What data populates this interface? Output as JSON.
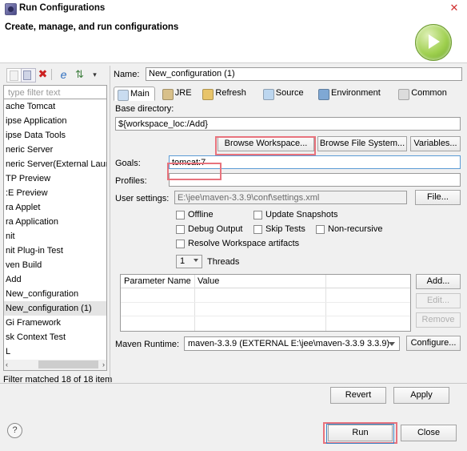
{
  "window": {
    "title": "Run Configurations",
    "subtitle": "Create, manage, and run configurations",
    "close_label": "✕",
    "run_banner_icon": "run-play-icon",
    "help_label": "?"
  },
  "left_toolbar": {
    "buttons": [
      {
        "name": "new-configuration-icon",
        "label": ""
      },
      {
        "name": "duplicate-configuration-icon",
        "label": ""
      },
      {
        "name": "delete-configuration-icon",
        "label": "✖"
      },
      {
        "name": "collapse-all-icon",
        "label": "e"
      },
      {
        "name": "filter-sort-icon",
        "label": "⇅"
      },
      {
        "name": "view-menu-caret-icon",
        "label": "▾"
      }
    ]
  },
  "filter": {
    "placeholder": "type filter text",
    "value": "",
    "status": "Filter matched 18 of 18 item"
  },
  "tree": {
    "items": [
      {
        "label": "ache Tomcat",
        "selected": false
      },
      {
        "label": "ipse Application",
        "selected": false
      },
      {
        "label": "ipse Data Tools",
        "selected": false
      },
      {
        "label": "neric Server",
        "selected": false
      },
      {
        "label": "neric Server(External Launch",
        "selected": false
      },
      {
        "label": "TP Preview",
        "selected": false
      },
      {
        "label": ":E Preview",
        "selected": false
      },
      {
        "label": "ra Applet",
        "selected": false
      },
      {
        "label": "ra Application",
        "selected": false
      },
      {
        "label": "nit",
        "selected": false
      },
      {
        "label": "nit Plug-in Test",
        "selected": false
      },
      {
        "label": "ven Build",
        "selected": false
      },
      {
        "label": "  Add",
        "selected": false
      },
      {
        "label": "  New_configuration",
        "selected": false
      },
      {
        "label": "  New_configuration (1)",
        "selected": true
      },
      {
        "label": "Gi Framework",
        "selected": false
      },
      {
        "label": "sk Context Test",
        "selected": false
      },
      {
        "label": "L",
        "selected": false
      }
    ],
    "scroll_left_arrow": "‹",
    "scroll_right_arrow": "›"
  },
  "config": {
    "name_label": "Name:",
    "name_value": "New_configuration (1)",
    "tabs": [
      {
        "label": "Main",
        "icon": "main-tab-icon",
        "active": true,
        "color": "#c9dcf0"
      },
      {
        "label": "JRE",
        "icon": "jre-tab-icon",
        "active": false,
        "color": "#d8c08a"
      },
      {
        "label": "Refresh",
        "icon": "refresh-tab-icon",
        "active": false,
        "color": "#e8c46a"
      },
      {
        "label": "Source",
        "icon": "source-tab-icon",
        "active": false,
        "color": "#bcd6ef"
      },
      {
        "label": "Environment",
        "icon": "environment-tab-icon",
        "active": false,
        "color": "#7fa8d4"
      },
      {
        "label": "Common",
        "icon": "common-tab-icon",
        "active": false,
        "color": "#dcdcdc"
      }
    ],
    "base_directory_label": "Base directory:",
    "base_directory_value": "${workspace_loc:/Add}",
    "browse_workspace_label": "Browse Workspace...",
    "browse_filesystem_label": "Browse File System...",
    "variables_label": "Variables...",
    "goals_label": "Goals:",
    "goals_value": "tomcat:7",
    "profiles_label": "Profiles:",
    "profiles_value": "",
    "user_settings_label": "User settings:",
    "user_settings_value": "E:\\jee\\maven-3.3.9\\conf\\settings.xml",
    "file_button_label": "File...",
    "checkboxes": [
      {
        "label": "Offline",
        "checked": false
      },
      {
        "label": "Update Snapshots",
        "checked": false
      },
      {
        "label": "Debug Output",
        "checked": false
      },
      {
        "label": "Skip Tests",
        "checked": false
      },
      {
        "label": "Non-recursive",
        "checked": false
      },
      {
        "label": "Resolve Workspace artifacts",
        "checked": false
      }
    ],
    "threads_value": "1",
    "threads_label": "Threads",
    "table": {
      "columns": [
        "Parameter Name",
        "Value"
      ],
      "rows": []
    },
    "add_label": "Add...",
    "edit_label": "Edit...",
    "remove_label": "Remove",
    "maven_runtime_label": "Maven Runtime:",
    "maven_runtime_value": "maven-3.3.9 (EXTERNAL E:\\jee\\maven-3.3.9 3.3.9)",
    "configure_label": "Configure..."
  },
  "actions": {
    "revert_label": "Revert",
    "apply_label": "Apply",
    "run_label": "Run",
    "close_label": "Close"
  },
  "annotations": {
    "accent_color": "#e8737d",
    "focus_color": "#3b86c8"
  }
}
